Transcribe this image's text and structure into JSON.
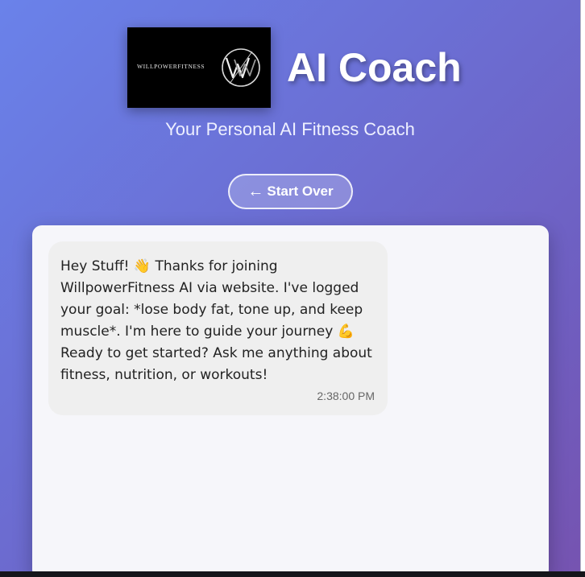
{
  "header": {
    "logo_text": "WILLPOWERFITNESS",
    "title": "AI Coach",
    "subtitle": "Your Personal AI Fitness Coach"
  },
  "actions": {
    "start_over_arrow": "←",
    "start_over_label": "Start Over"
  },
  "chat": {
    "messages": [
      {
        "text": "Hey Stuff! 👋 Thanks for joining WillpowerFitness AI via website. I've logged your goal: *lose body fat, tone up, and keep muscle*. I'm here to guide your journey 💪 Ready to get started? Ask me anything about fitness, nutrition, or workouts!",
        "time": "2:38:00 PM"
      }
    ]
  },
  "colors": {
    "bg_start": "#6a82ea",
    "bg_end": "#7653b0",
    "panel": "#f6f6fa",
    "bubble": "#efefef"
  }
}
